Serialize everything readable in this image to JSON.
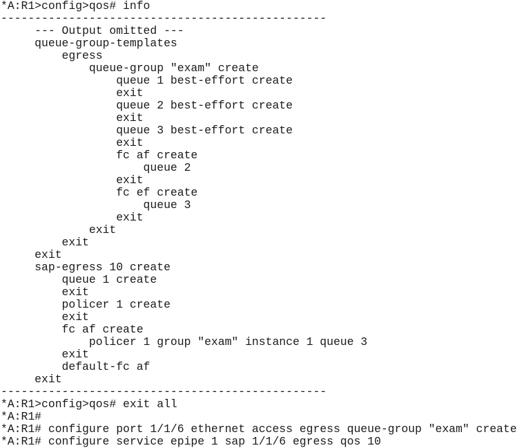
{
  "terminal": {
    "prompt_config_qos": "*A:R1>config>qos#",
    "prompt_root": "*A:R1#",
    "separator": "------------------------------------------------",
    "lines": [
      {
        "indent": 0,
        "text": "*A:R1>config>qos# info",
        "kind": "command"
      },
      {
        "indent": 0,
        "text": "------------------------------------------------",
        "kind": "separator"
      },
      {
        "indent": 5,
        "text": "--- Output omitted ---",
        "kind": "output"
      },
      {
        "indent": 5,
        "text": "queue-group-templates",
        "kind": "output"
      },
      {
        "indent": 9,
        "text": "egress",
        "kind": "output"
      },
      {
        "indent": 13,
        "text": "queue-group \"exam\" create",
        "kind": "output"
      },
      {
        "indent": 17,
        "text": "queue 1 best-effort create",
        "kind": "output"
      },
      {
        "indent": 17,
        "text": "exit",
        "kind": "output"
      },
      {
        "indent": 17,
        "text": "queue 2 best-effort create",
        "kind": "output"
      },
      {
        "indent": 17,
        "text": "exit",
        "kind": "output"
      },
      {
        "indent": 17,
        "text": "queue 3 best-effort create",
        "kind": "output"
      },
      {
        "indent": 17,
        "text": "exit",
        "kind": "output"
      },
      {
        "indent": 17,
        "text": "fc af create",
        "kind": "output"
      },
      {
        "indent": 21,
        "text": "queue 2",
        "kind": "output"
      },
      {
        "indent": 17,
        "text": "exit",
        "kind": "output"
      },
      {
        "indent": 17,
        "text": "fc ef create",
        "kind": "output"
      },
      {
        "indent": 21,
        "text": "queue 3",
        "kind": "output"
      },
      {
        "indent": 17,
        "text": "exit",
        "kind": "output"
      },
      {
        "indent": 13,
        "text": "exit",
        "kind": "output"
      },
      {
        "indent": 9,
        "text": "exit",
        "kind": "output"
      },
      {
        "indent": 5,
        "text": "exit",
        "kind": "output"
      },
      {
        "indent": 5,
        "text": "sap-egress 10 create",
        "kind": "output"
      },
      {
        "indent": 9,
        "text": "queue 1 create",
        "kind": "output"
      },
      {
        "indent": 9,
        "text": "exit",
        "kind": "output"
      },
      {
        "indent": 9,
        "text": "policer 1 create",
        "kind": "output"
      },
      {
        "indent": 9,
        "text": "exit",
        "kind": "output"
      },
      {
        "indent": 9,
        "text": "fc af create",
        "kind": "output"
      },
      {
        "indent": 13,
        "text": "policer 1 group \"exam\" instance 1 queue 3",
        "kind": "output"
      },
      {
        "indent": 9,
        "text": "exit",
        "kind": "output"
      },
      {
        "indent": 9,
        "text": "default-fc af",
        "kind": "output"
      },
      {
        "indent": 5,
        "text": "exit",
        "kind": "output"
      },
      {
        "indent": 0,
        "text": "------------------------------------------------",
        "kind": "separator"
      },
      {
        "indent": 0,
        "text": "*A:R1>config>qos# exit all",
        "kind": "command"
      },
      {
        "indent": 0,
        "text": "*A:R1#",
        "kind": "command"
      },
      {
        "indent": 0,
        "text": "*A:R1# configure port 1/1/6 ethernet access egress queue-group \"exam\" create",
        "kind": "command"
      },
      {
        "indent": 0,
        "text": "*A:R1# configure service epipe 1 sap 1/1/6 egress qos 10",
        "kind": "command"
      }
    ]
  },
  "colors": {
    "background": "#ffffff",
    "text": "#1a1a1a"
  }
}
